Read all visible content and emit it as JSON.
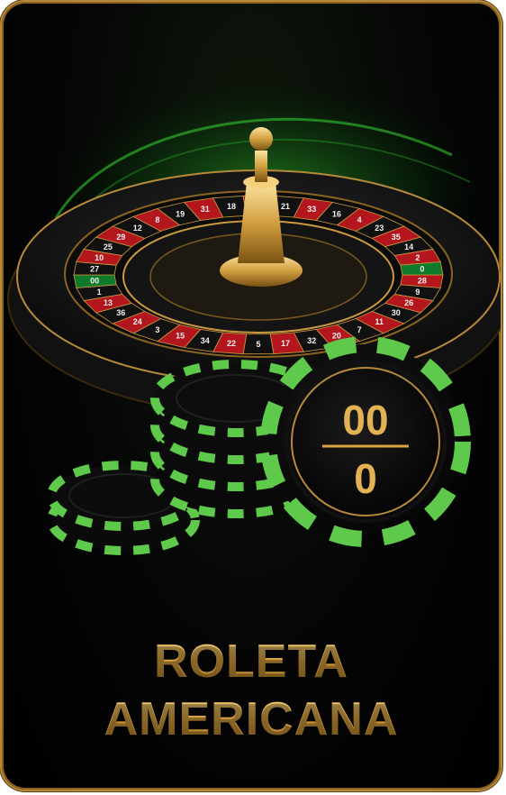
{
  "card": {
    "title_line1": "ROLETA",
    "title_line2": "AMERICANA"
  },
  "main_chip": {
    "top_label": "00",
    "bottom_label": "0"
  },
  "colors": {
    "gold": "#d9a441",
    "chip_green": "#5ec94a",
    "wheel_red": "#b3171d",
    "wheel_green": "#0e7a2a",
    "background": "#050505"
  },
  "wheel_numbers": [
    "28",
    "9",
    "26",
    "30",
    "11",
    "7",
    "20",
    "32",
    "17",
    "5",
    "22",
    "34",
    "15",
    "3",
    "24",
    "36",
    "13",
    "1",
    "00",
    "27",
    "10",
    "25",
    "29",
    "12",
    "8",
    "19",
    "31",
    "18",
    "6",
    "21",
    "33",
    "16",
    "4",
    "23",
    "35",
    "14",
    "2",
    "0"
  ],
  "icons": [
    "roulette-wheel-icon",
    "gold-turret-icon",
    "poker-chip-icon"
  ]
}
